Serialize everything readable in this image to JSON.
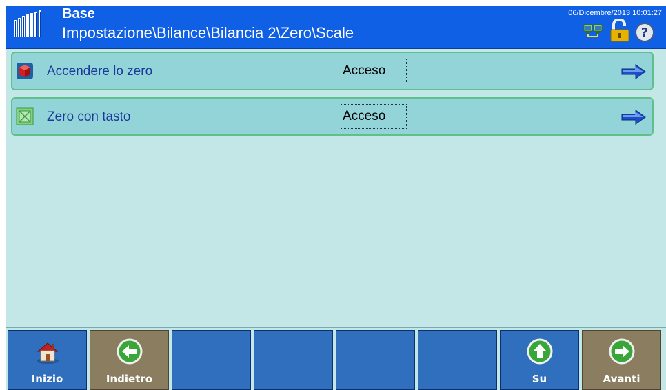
{
  "header": {
    "title": "Base",
    "path": "Impostazione\\Bilance\\Bilancia 2\\Zero\\Scale",
    "datetime": "06/Dicembre/2013 10:01:27",
    "icons": [
      "network-icon",
      "lock-icon",
      "help-icon"
    ]
  },
  "rows": [
    {
      "label": "Accendere lo zero",
      "value": "Acceso",
      "icon": "zero-cube-icon"
    },
    {
      "label": "Zero con tasto",
      "value": "Acceso",
      "icon": "zero-key-icon"
    }
  ],
  "footer": {
    "buttons": [
      {
        "label": "Inizio",
        "icon": "home-icon"
      },
      {
        "label": "Indietro",
        "icon": "back-arrow-icon"
      },
      {
        "label": ""
      },
      {
        "label": ""
      },
      {
        "label": ""
      },
      {
        "label": ""
      },
      {
        "label": "Su",
        "icon": "up-arrow-icon"
      },
      {
        "label": "Avanti",
        "icon": "forward-arrow-icon"
      }
    ]
  },
  "colors": {
    "header_bg": "#1060e6",
    "content_bg": "#c3e7e6",
    "row_bg": "#93d4d8",
    "row_border": "#5fc08a",
    "button_blue": "#2f6fbe",
    "button_tan": "#8b7d60"
  }
}
